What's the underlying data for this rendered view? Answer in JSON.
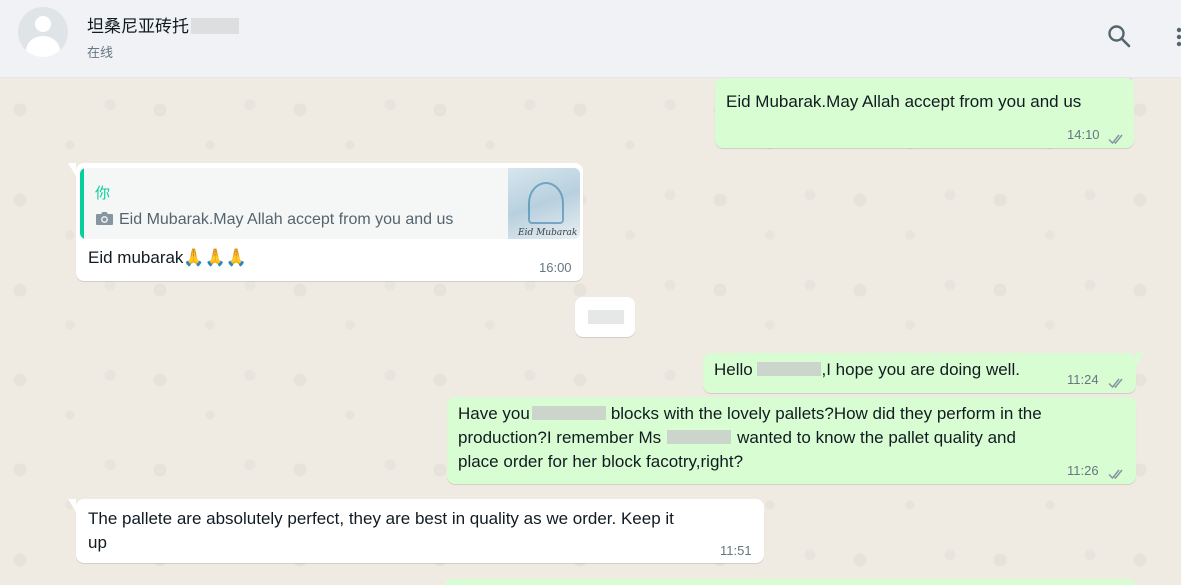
{
  "header": {
    "contact_name": "坦桑尼亚砖托",
    "status": "在线",
    "search_icon": "search-icon",
    "menu_icon": "kebab-menu-icon"
  },
  "messages": [
    {
      "direction": "outgoing",
      "text": "Eid Mubarak.May Allah accept from you and us",
      "time": "14:10",
      "status": "read"
    },
    {
      "direction": "incoming",
      "quote": {
        "author": "你",
        "text": "Eid Mubarak.May Allah accept from you and us",
        "thumbnail_caption": "Eid Mubarak",
        "icon": "camera-icon"
      },
      "text": "Eid mubarak🙏🙏🙏",
      "time": "16:00"
    },
    {
      "direction": "outgoing",
      "text_before": "Hello",
      "text_after": ",I hope you are doing well.",
      "time": "11:24",
      "status": "read"
    },
    {
      "direction": "outgoing",
      "line1_a": "Have you",
      "line1_b": "blocks with the lovely pallets?How did they perform in the",
      "line2_a": "production?I remember Ms",
      "line2_b": "wanted to know the pallet quality and",
      "line3": "place order for her block facotry,right?",
      "time": "11:26",
      "status": "read"
    },
    {
      "direction": "incoming",
      "line1": "The pallete are absolutely perfect, they are best in quality as we order. Keep it",
      "line2": "up",
      "time": "11:51"
    }
  ],
  "colors": {
    "outgoing_bubble": "#d9fdd3",
    "incoming_bubble": "#ffffff",
    "header_bg": "#f0f2f5",
    "wallpaper": "#efeae2",
    "quote_accent": "#06cf9c"
  }
}
